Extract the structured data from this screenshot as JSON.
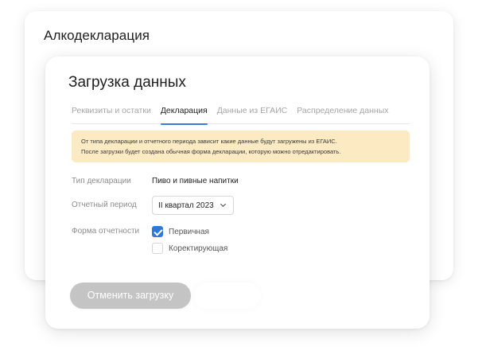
{
  "app": {
    "title": "Алкодекларация"
  },
  "dialog": {
    "title": "Загрузка данных",
    "tabs": [
      {
        "label": "Реквизиты и остатки",
        "active": false
      },
      {
        "label": "Декларация",
        "active": true
      },
      {
        "label": "Данные из ЕГАИС",
        "active": false
      },
      {
        "label": "Распределение данных",
        "active": false
      }
    ],
    "notice": {
      "line1": "От типа декларации и отчетного периода зависит какие данные будут загружены из ЕГАИС.",
      "line2": "После загрузки будет создана обычная форма декларации, которую можно отредактировать."
    },
    "fields": {
      "type_label": "Тип декларации",
      "type_value": "Пиво и пивные напитки",
      "period_label": "Отчетный период",
      "period_value": "II квартал 2023",
      "form_label": "Форма отчетности",
      "form_options": [
        {
          "label": "Первичная",
          "checked": true
        },
        {
          "label": "Коректирующая",
          "checked": false
        }
      ]
    },
    "cancel_label": "Отменить загрузку"
  },
  "colors": {
    "accent": "#2f78d6",
    "notice_bg": "#fbeac2",
    "button_disabled": "#c4c4c4"
  }
}
